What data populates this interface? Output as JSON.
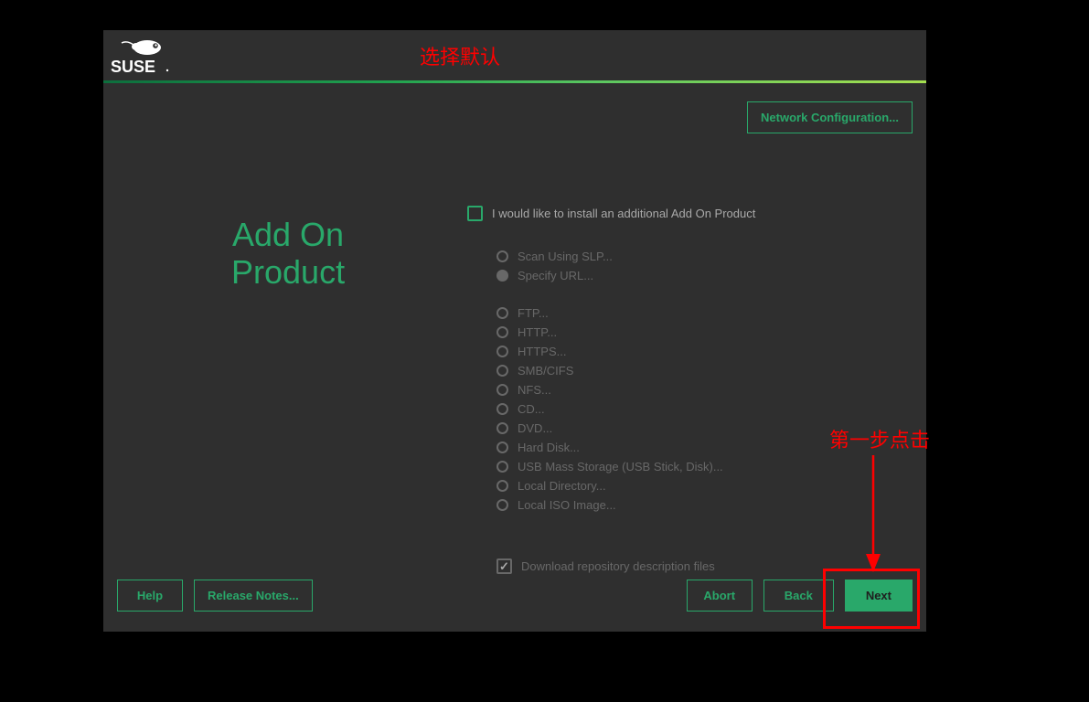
{
  "brand": "SUSE",
  "page_title_line1": "Add On",
  "page_title_line2": "Product",
  "top_button": "Network Configuration...",
  "addon_checkbox_label": "I would like to install an additional Add On Product",
  "radios_group1": [
    {
      "label": "Scan Using SLP...",
      "selected": false
    },
    {
      "label": "Specify URL...",
      "selected": true
    }
  ],
  "radios_group2": [
    {
      "label": "FTP...",
      "selected": false
    },
    {
      "label": "HTTP...",
      "selected": false
    },
    {
      "label": "HTTPS...",
      "selected": false
    },
    {
      "label": "SMB/CIFS",
      "selected": false
    },
    {
      "label": "NFS...",
      "selected": false
    },
    {
      "label": "CD...",
      "selected": false
    },
    {
      "label": "DVD...",
      "selected": false
    },
    {
      "label": "Hard Disk...",
      "selected": false
    },
    {
      "label": "USB Mass Storage (USB Stick, Disk)...",
      "selected": false
    },
    {
      "label": "Local Directory...",
      "selected": false
    },
    {
      "label": "Local ISO Image...",
      "selected": false
    }
  ],
  "download_checkbox_label": "Download repository description files",
  "download_checked": true,
  "footer": {
    "help": "Help",
    "release_notes": "Release Notes...",
    "abort": "Abort",
    "back": "Back",
    "next": "Next"
  },
  "annotations": {
    "top": "选择默认",
    "side": "第一步点击"
  }
}
